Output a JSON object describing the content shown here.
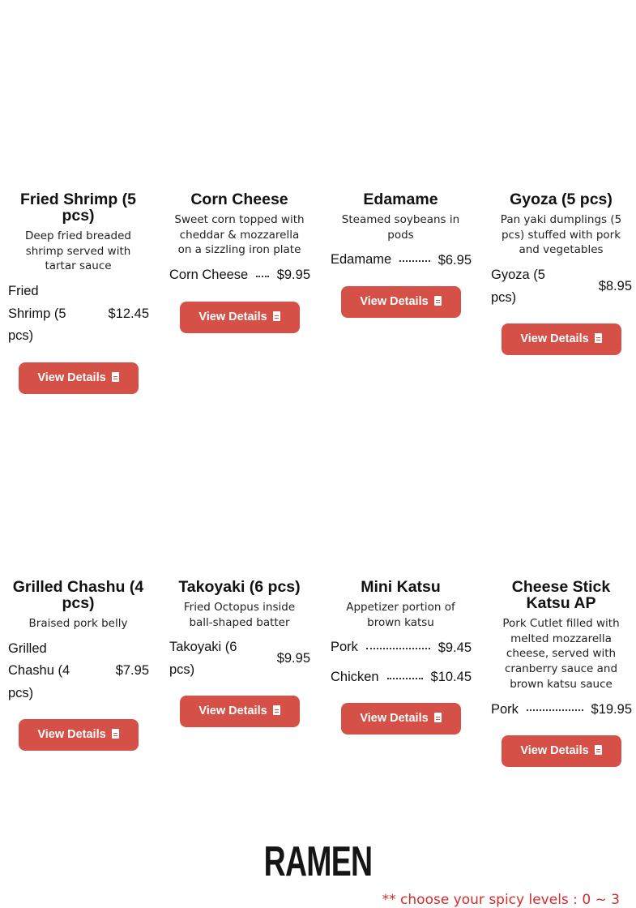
{
  "row1": [
    {
      "title": "Fried Shrimp (5 pcs)",
      "description": "Deep fried breaded shrimp served with tartar sauce",
      "prices": [
        {
          "name": "Fried Shrimp (5 pcs)",
          "price": "$12.45"
        }
      ],
      "button": "View Details"
    },
    {
      "title": "Corn Cheese",
      "description": "Sweet corn topped with cheddar & mozzarella on a sizzling iron plate",
      "prices": [
        {
          "name": "Corn Cheese",
          "price": "$9.95"
        }
      ],
      "button": "View Details"
    },
    {
      "title": "Edamame",
      "description": "Steamed soybeans in pods",
      "prices": [
        {
          "name": "Edamame",
          "price": "$6.95"
        }
      ],
      "button": "View Details"
    },
    {
      "title": "Gyoza (5 pcs)",
      "description": "Pan yaki dumplings (5 pcs) stuffed with pork and vegetables",
      "prices": [
        {
          "name": "Gyoza (5 pcs)",
          "price": "$8.95"
        }
      ],
      "button": "View Details"
    }
  ],
  "row2": [
    {
      "title": "Grilled Chashu (4 pcs)",
      "description": "Braised pork belly",
      "prices": [
        {
          "name": "Grilled Chashu (4 pcs)",
          "price": "$7.95"
        }
      ],
      "button": "View Details"
    },
    {
      "title": "Takoyaki (6 pcs)",
      "description": "Fried Octopus inside ball-shaped batter",
      "prices": [
        {
          "name": "Takoyaki (6 pcs)",
          "price": "$9.95"
        }
      ],
      "button": "View Details"
    },
    {
      "title": "Mini Katsu",
      "description": "Appetizer portion of brown katsu",
      "prices": [
        {
          "name": "Pork",
          "price": "$9.45"
        },
        {
          "name": "Chicken",
          "price": "$10.45"
        }
      ],
      "button": "View Details"
    },
    {
      "title": "Cheese Stick Katsu AP",
      "description": "Pork Cutlet filled with melted mozzarella cheese, served with cranberry sauce and brown katsu sauce",
      "prices": [
        {
          "name": "Pork",
          "price": "$19.95"
        }
      ],
      "button": "View Details"
    }
  ],
  "section": {
    "title": "RAMEN",
    "note": "** choose your spicy levels : 0 ~ 3"
  },
  "colors": {
    "button": "#d55148",
    "note": "#d52b2b"
  },
  "icons": {
    "button_icon": "file-document-icon"
  }
}
